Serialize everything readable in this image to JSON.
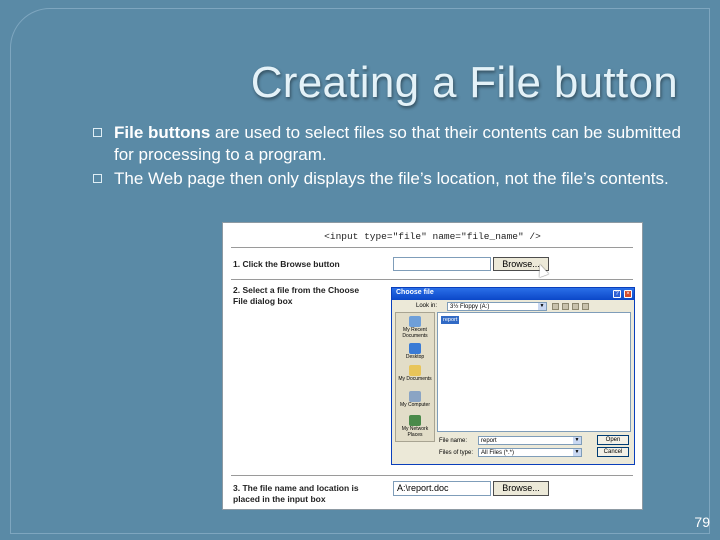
{
  "slide": {
    "title": "Creating a File button",
    "bullets": [
      {
        "bold": "File buttons",
        "text": " are used to select files so that their contents can be submitted for processing to a program."
      },
      {
        "bold": "",
        "text": "The Web page then only displays the file’s location, not the file’s contents."
      }
    ],
    "page_number": "79"
  },
  "figure": {
    "code": "<input type=\"file\" name=\"file_name\" />",
    "step1": "1. Click the Browse button",
    "step2_line1": "2. Select a file from the Choose",
    "step2_line2": "File dialog box",
    "step3_line1": "3. The file name and location is",
    "step3_line2": "placed in the input box",
    "browse_label": "Browse...",
    "result_value": "A:\\report.doc",
    "dialog": {
      "title": "Choose file",
      "look_in_label": "Look in:",
      "look_in_value": "3½ Floppy (A:)",
      "places": [
        "My Recent Documents",
        "Desktop",
        "My Documents",
        "My Computer",
        "My Network Places"
      ],
      "selected_file": "report",
      "file_name_label": "File name:",
      "file_name_value": "report",
      "files_of_type_label": "Files of type:",
      "files_of_type_value": "All Files (*.*)",
      "open_button": "Open",
      "cancel_button": "Cancel"
    }
  }
}
